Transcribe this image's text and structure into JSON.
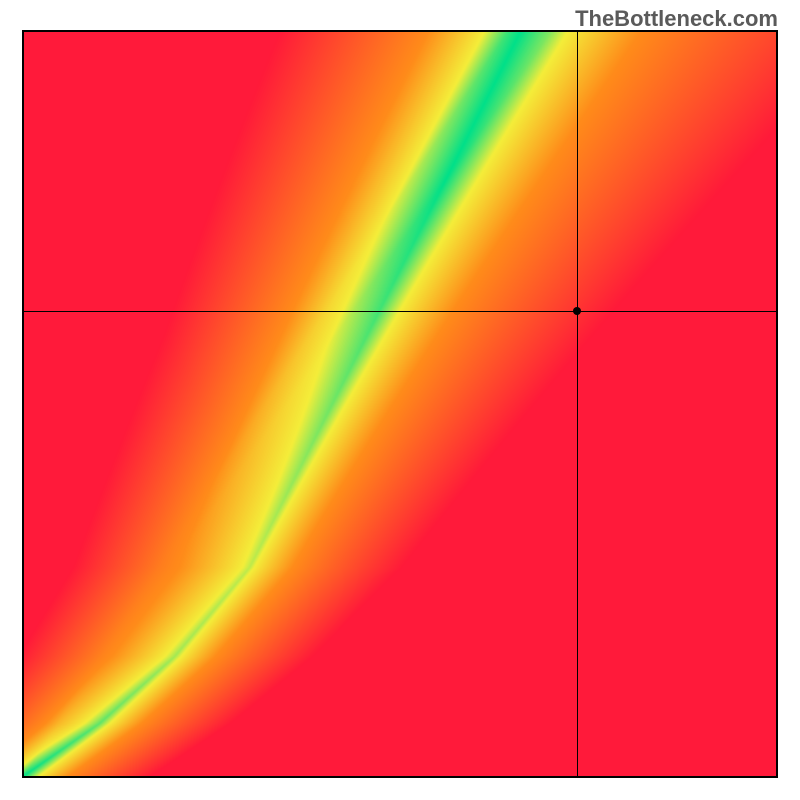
{
  "watermark": "TheBottleneck.com",
  "chart_data": {
    "type": "heatmap",
    "title": "",
    "xlabel": "",
    "ylabel": "",
    "xlim": [
      0,
      1
    ],
    "ylim": [
      0,
      1
    ],
    "grid": false,
    "legend": false,
    "color_scale": {
      "optimal": "#00e08a",
      "near": "#f4ee3a",
      "mid": "#ff8c1a",
      "far": "#ff1a3a"
    },
    "marker": {
      "x": 0.735,
      "y": 0.625
    },
    "crosshair": {
      "x": 0.735,
      "y": 0.625
    },
    "ridge": {
      "description": "green optimal band curve rising from lower-left toward upper-right, steeper than y=x",
      "points_xy": [
        [
          0.0,
          0.0
        ],
        [
          0.1,
          0.07
        ],
        [
          0.2,
          0.16
        ],
        [
          0.3,
          0.28
        ],
        [
          0.36,
          0.4
        ],
        [
          0.42,
          0.52
        ],
        [
          0.48,
          0.64
        ],
        [
          0.54,
          0.76
        ],
        [
          0.6,
          0.88
        ],
        [
          0.66,
          1.0
        ]
      ],
      "band_halfwidth_x": 0.05
    },
    "secondary_lobe": {
      "description": "yellow-orange attraction toward upper-right corner",
      "center_xy": [
        1.0,
        1.0
      ],
      "strength": 0.4
    }
  }
}
